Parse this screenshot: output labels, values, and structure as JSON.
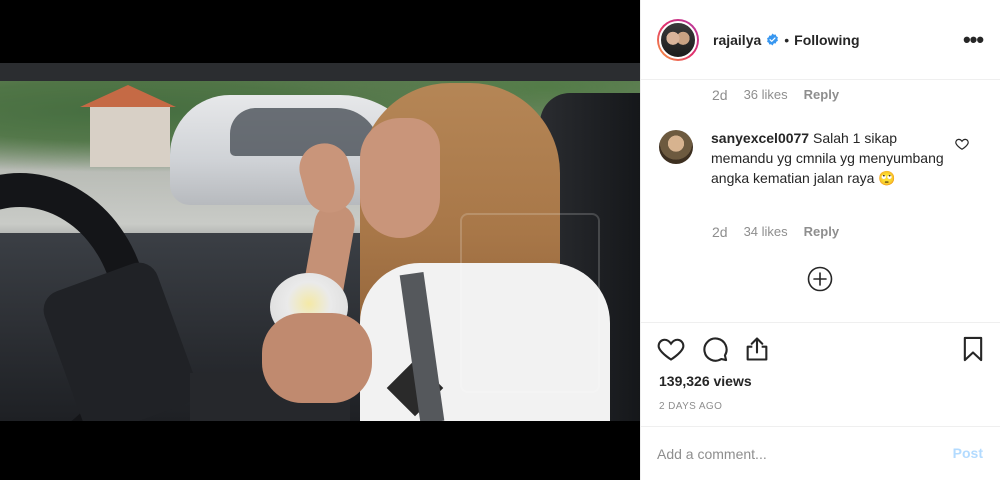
{
  "post": {
    "username": "rajailya",
    "separator": "•",
    "follow_label": "Following",
    "more_glyph": "•••"
  },
  "comments": [
    {
      "time": "2d",
      "likes": "36 likes",
      "reply": "Reply"
    },
    {
      "username": "sanyexcel0077",
      "text": " Salah 1 sikap memandu yg cmnila yg menyumbang angka kematian jalan raya 🙄",
      "time": "2d",
      "likes": "34 likes",
      "reply": "Reply"
    }
  ],
  "stats": {
    "views": "139,326 views",
    "date": "2 DAYS AGO"
  },
  "add_comment": {
    "placeholder": "Add a comment...",
    "post_label": "Post"
  },
  "colors": {
    "verified": "#3897f0",
    "post_disabled": "#b3dbff",
    "muted": "#8e8e8e"
  }
}
